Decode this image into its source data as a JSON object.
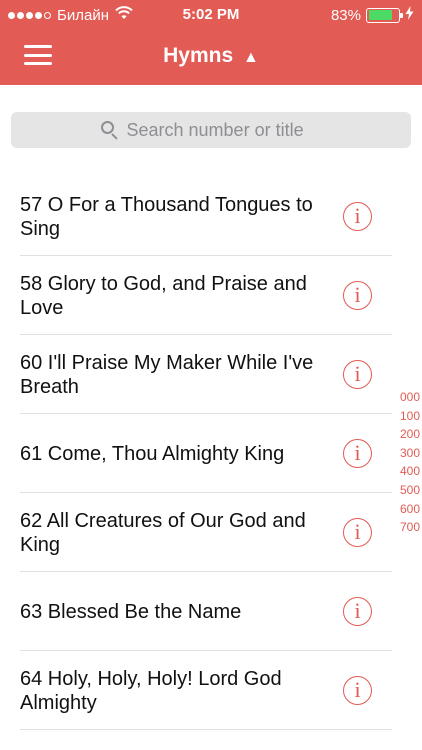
{
  "status_bar": {
    "carrier": "Билайн",
    "time": "5:02 PM",
    "battery": "83%",
    "battery_level": 0.83,
    "signal_dots": 5,
    "signal_filled": 4,
    "icons": [
      "signal-dots-icon",
      "wifi-icon",
      "battery-icon",
      "charging-bolt-icon"
    ]
  },
  "nav": {
    "title": "Hymns",
    "title_indicator": "▲",
    "menu_icon": "hamburger-icon"
  },
  "search": {
    "placeholder": "Search number or title",
    "value": "",
    "icon": "search-icon"
  },
  "hymns": [
    {
      "title": "57 O For a Thousand Tongues to Sing"
    },
    {
      "title": "58 Glory to God, and Praise and Love"
    },
    {
      "title": "60 I'll Praise My Maker While I've Breath"
    },
    {
      "title": "61 Come, Thou Almighty King"
    },
    {
      "title": "62 All Creatures of Our God and King"
    },
    {
      "title": "63 Blessed Be the Name"
    },
    {
      "title": "64 Holy, Holy, Holy! Lord God Almighty"
    }
  ],
  "info_glyph": "i",
  "index": [
    "000",
    "100",
    "200",
    "300",
    "400",
    "500",
    "600",
    "700"
  ],
  "colors": {
    "accent": "#e35b55",
    "battery_fill": "#4cd964",
    "search_bg": "#e5e5e6",
    "separator": "#e1e1e3"
  }
}
